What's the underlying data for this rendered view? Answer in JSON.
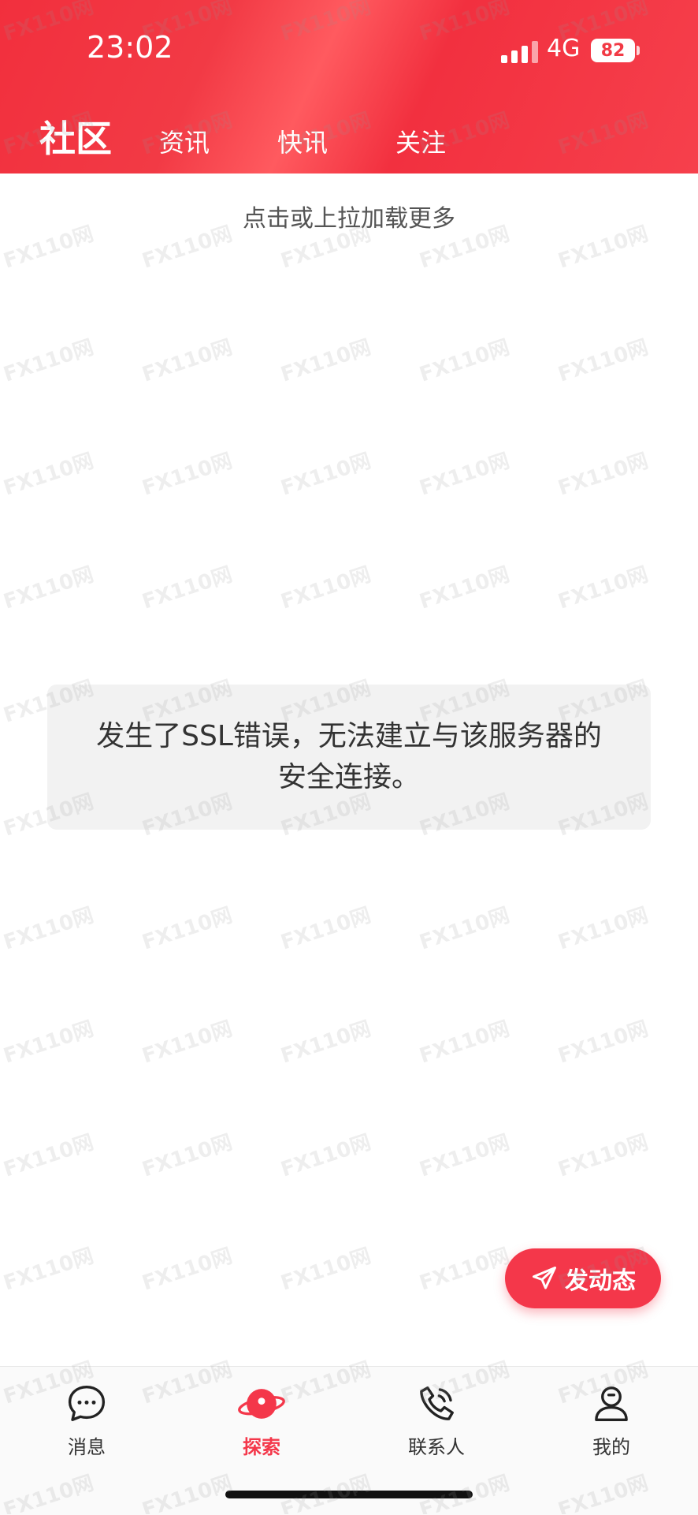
{
  "status_bar": {
    "time": "23:02",
    "network": "4G",
    "battery": "82"
  },
  "header": {
    "title": "社区",
    "tabs": [
      {
        "label": "资讯"
      },
      {
        "label": "快讯"
      },
      {
        "label": "关注"
      }
    ]
  },
  "feed": {
    "load_more": "点击或上拉加载更多"
  },
  "toast": {
    "message": "发生了SSL错误，无法建立与该服务器的安全连接。"
  },
  "fab": {
    "label": "发动态",
    "icon": "send-icon"
  },
  "bottom_nav": {
    "items": [
      {
        "label": "消息",
        "icon": "chat-bubble-icon",
        "active": false
      },
      {
        "label": "探索",
        "icon": "planet-icon",
        "active": true
      },
      {
        "label": "联系人",
        "icon": "phone-icon",
        "active": false
      },
      {
        "label": "我的",
        "icon": "user-icon",
        "active": false
      }
    ]
  },
  "watermark": {
    "text": "FX110网"
  },
  "colors": {
    "accent": "#f4374a",
    "header_bg": "#f23a45"
  }
}
